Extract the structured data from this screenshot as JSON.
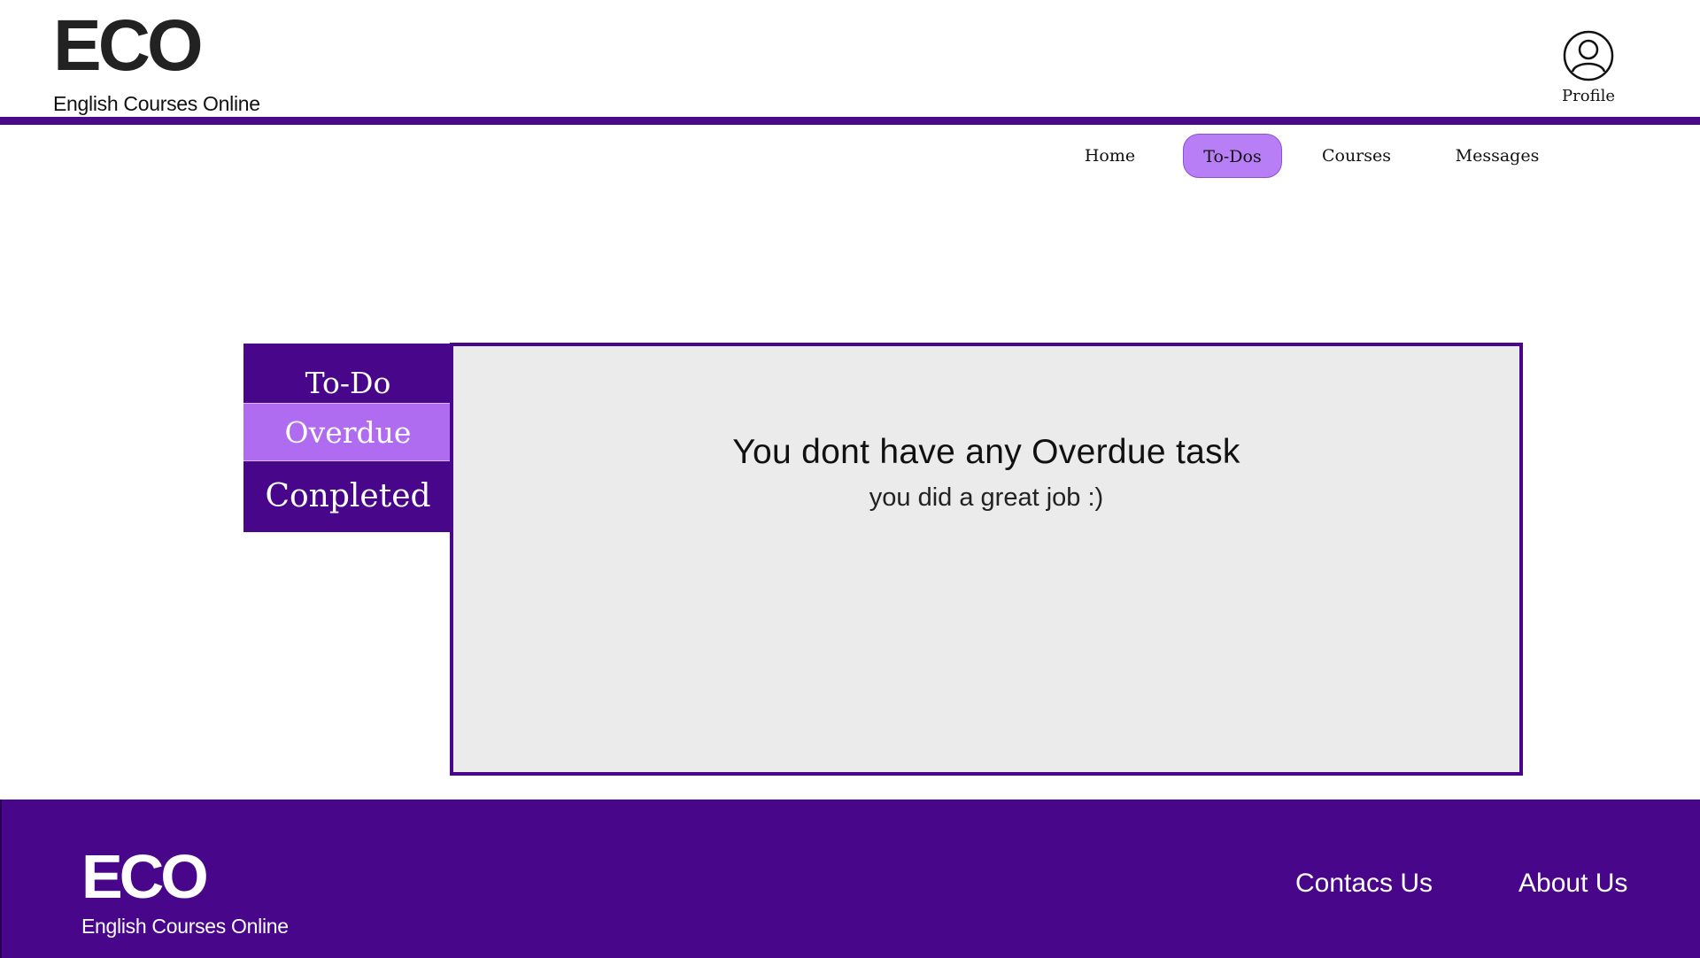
{
  "brand": {
    "logo": "ECO",
    "tagline": "English Courses Online"
  },
  "header": {
    "profile_label": "Profile",
    "profile_icon": "user-circle-icon"
  },
  "nav": {
    "items": [
      {
        "label": "Home"
      },
      {
        "label": "To-Dos",
        "active": true
      },
      {
        "label": "Courses"
      },
      {
        "label": "Messages"
      }
    ]
  },
  "sidebar": {
    "tabs": [
      {
        "label": "To-Do"
      },
      {
        "label": "Overdue",
        "active": true
      },
      {
        "label": "Conpleted"
      }
    ]
  },
  "panel": {
    "title": "You dont have any Overdue task",
    "subtitle": "you did a great job :)"
  },
  "footer": {
    "logo": "ECO",
    "tagline": "English Courses Online",
    "links": [
      {
        "label": "Contacs Us"
      },
      {
        "label": "About Us"
      }
    ]
  },
  "colors": {
    "brand_purple": "#48068a",
    "active_purple": "#b06cf0",
    "nav_active": "#b87ef5",
    "panel_bg": "#ebebeb"
  }
}
